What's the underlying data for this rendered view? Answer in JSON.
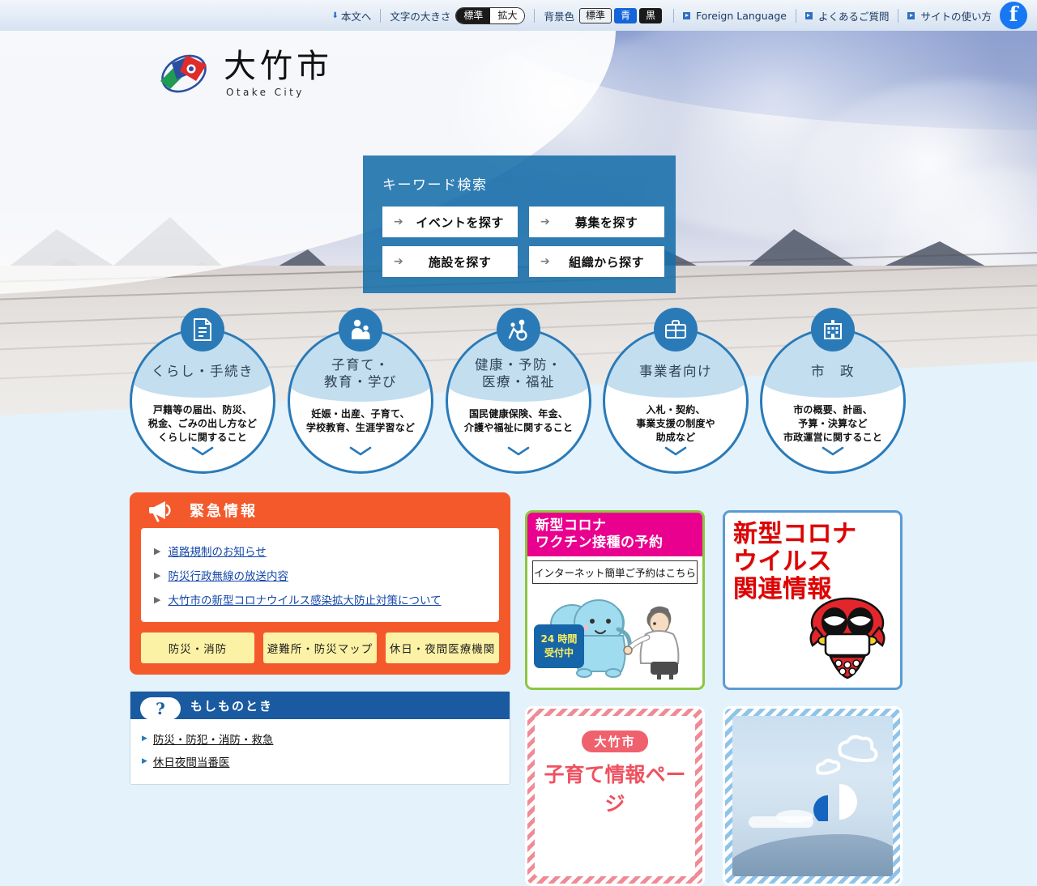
{
  "topbar": {
    "skip_link": "本文へ",
    "textsize_label": "文字の大きさ",
    "textsize_options": [
      "標準",
      "拡大"
    ],
    "bgcolor_label": "背景色",
    "bgcolor_options": [
      "標準",
      "青",
      "黒"
    ],
    "links": [
      "Foreign Language",
      "よくあるご質問",
      "サイトの使い方"
    ],
    "facebook_icon": "facebook-icon",
    "facebook_glyph": "f"
  },
  "logo": {
    "name_jp": "大竹市",
    "name_en": "Otake City"
  },
  "search": {
    "title": "キーワード検索",
    "buttons": [
      {
        "label": "イベントを探す"
      },
      {
        "label": "募集を探す"
      },
      {
        "label": "施設を探す"
      },
      {
        "label": "組織から探す"
      }
    ]
  },
  "categories": [
    {
      "title": "くらし・手続き",
      "desc": "戸籍等の届出、防災、\n税金、ごみの出し方など\nくらしに関すること",
      "icon": "document-icon"
    },
    {
      "title": "子育て・\n教育・学び",
      "desc": "妊娠・出産、子育て、\n学校教育、生涯学習など",
      "icon": "parent-child-icon"
    },
    {
      "title": "健康・予防・\n医療・福祉",
      "desc": "国民健康保険、年金、\n介護や福祉に関すること",
      "icon": "wheelchair-care-icon"
    },
    {
      "title": "事業者向け",
      "desc": "入札・契約、\n事業支援の制度や\n助成など",
      "icon": "briefcase-icon"
    },
    {
      "title": "市　政",
      "desc": "市の概要、計画、\n予算・決算など\n市政運営に関すること",
      "icon": "city-hall-icon"
    }
  ],
  "emergency": {
    "title": "緊急情報",
    "icon": "megaphone-icon",
    "links": [
      "道路規制のお知らせ",
      "防災行政無線の放送内容",
      "大竹市の新型コロナウイルス感染拡大防止対策について"
    ],
    "buttons": [
      "防災・消防",
      "避難所・防災マップ",
      "休日・夜間医療機関"
    ],
    "accent_color": "#f4592c",
    "button_color": "#fcf2a6"
  },
  "moshimono": {
    "title": "もしものとき",
    "icon": "question-mark-icon",
    "icon_glyph": "?",
    "links": [
      "防災・防犯・消防・救急",
      "休日夜間当番医"
    ],
    "header_color": "#1a5aa0"
  },
  "banners": [
    {
      "name": "vaccine-reservation-banner",
      "heading_line1": "新型コロナ",
      "heading_line2": "ワクチン接種の予約",
      "subtitle": "インターネット簡単ご予約はこちら",
      "badge_line1": "24 時間",
      "badge_line2": "受付中",
      "header_color": "#e9008f",
      "border_color": "#8dc63f"
    },
    {
      "name": "corona-info-banner",
      "line1": "新型コロナ",
      "line2": "ウイルス",
      "line3": "関連情報",
      "text_color": "#e00000",
      "border_color": "#5b9bd5"
    },
    {
      "name": "childcare-info-banner",
      "chip": "大竹市",
      "title": "子育て情報ページ"
    },
    {
      "name": "sky-landscape-banner",
      "title": ""
    }
  ]
}
